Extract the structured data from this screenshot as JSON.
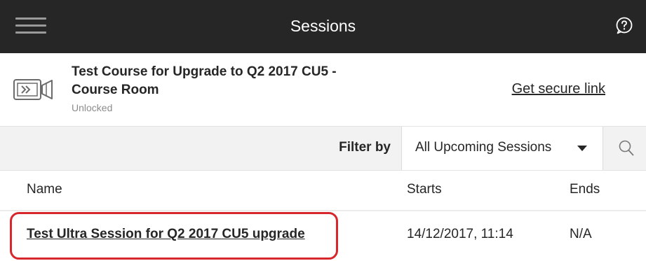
{
  "app_bar": {
    "title": "Sessions",
    "menu_icon": "hamburger-menu-icon",
    "help_icon": "help-question-icon"
  },
  "room": {
    "icon": "video-camera-icon",
    "title": "Test Course for Upgrade to Q2 2017 CU5 - Course Room",
    "status": "Unlocked",
    "secure_link_label": "Get secure link"
  },
  "filter": {
    "label": "Filter by",
    "selected": "All Upcoming Sessions",
    "search_icon": "search-icon"
  },
  "table": {
    "columns": [
      "Name",
      "Starts",
      "Ends"
    ],
    "rows": [
      {
        "name": "Test Ultra Session for Q2 2017 CU5 upgrade",
        "starts": "14/12/2017, 11:14",
        "ends": "N/A",
        "highlighted": true
      }
    ]
  },
  "colors": {
    "app_bar_bg": "#262626",
    "filter_bar_bg": "#f2f2f2",
    "highlight_border": "#d7262c"
  }
}
